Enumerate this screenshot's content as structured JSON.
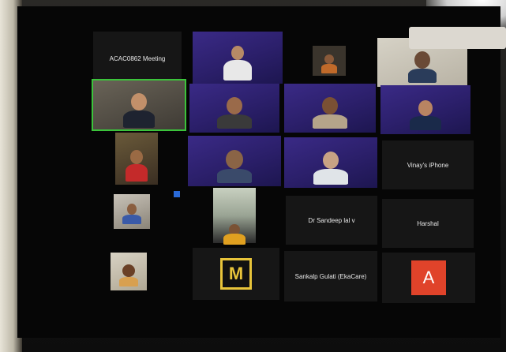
{
  "meeting": {
    "title": "ACAC0862 Meeting"
  },
  "participants": [
    {
      "id": "vinay",
      "name": "Vinay's iPhone"
    },
    {
      "id": "sandeep",
      "name": "Dr Sandeep lal v"
    },
    {
      "id": "harshal",
      "name": "Harshal"
    },
    {
      "id": "sankalp",
      "name": "Sankalp Gulati (EkaCare)"
    },
    {
      "id": "a-user",
      "avatar_letter": "A"
    }
  ],
  "colors": {
    "active_speaker_border": "#3bc43b",
    "avatar_a": "#e0432a",
    "logo_yellow": "#e8c43a",
    "bg_purple": "#3a2a86"
  }
}
